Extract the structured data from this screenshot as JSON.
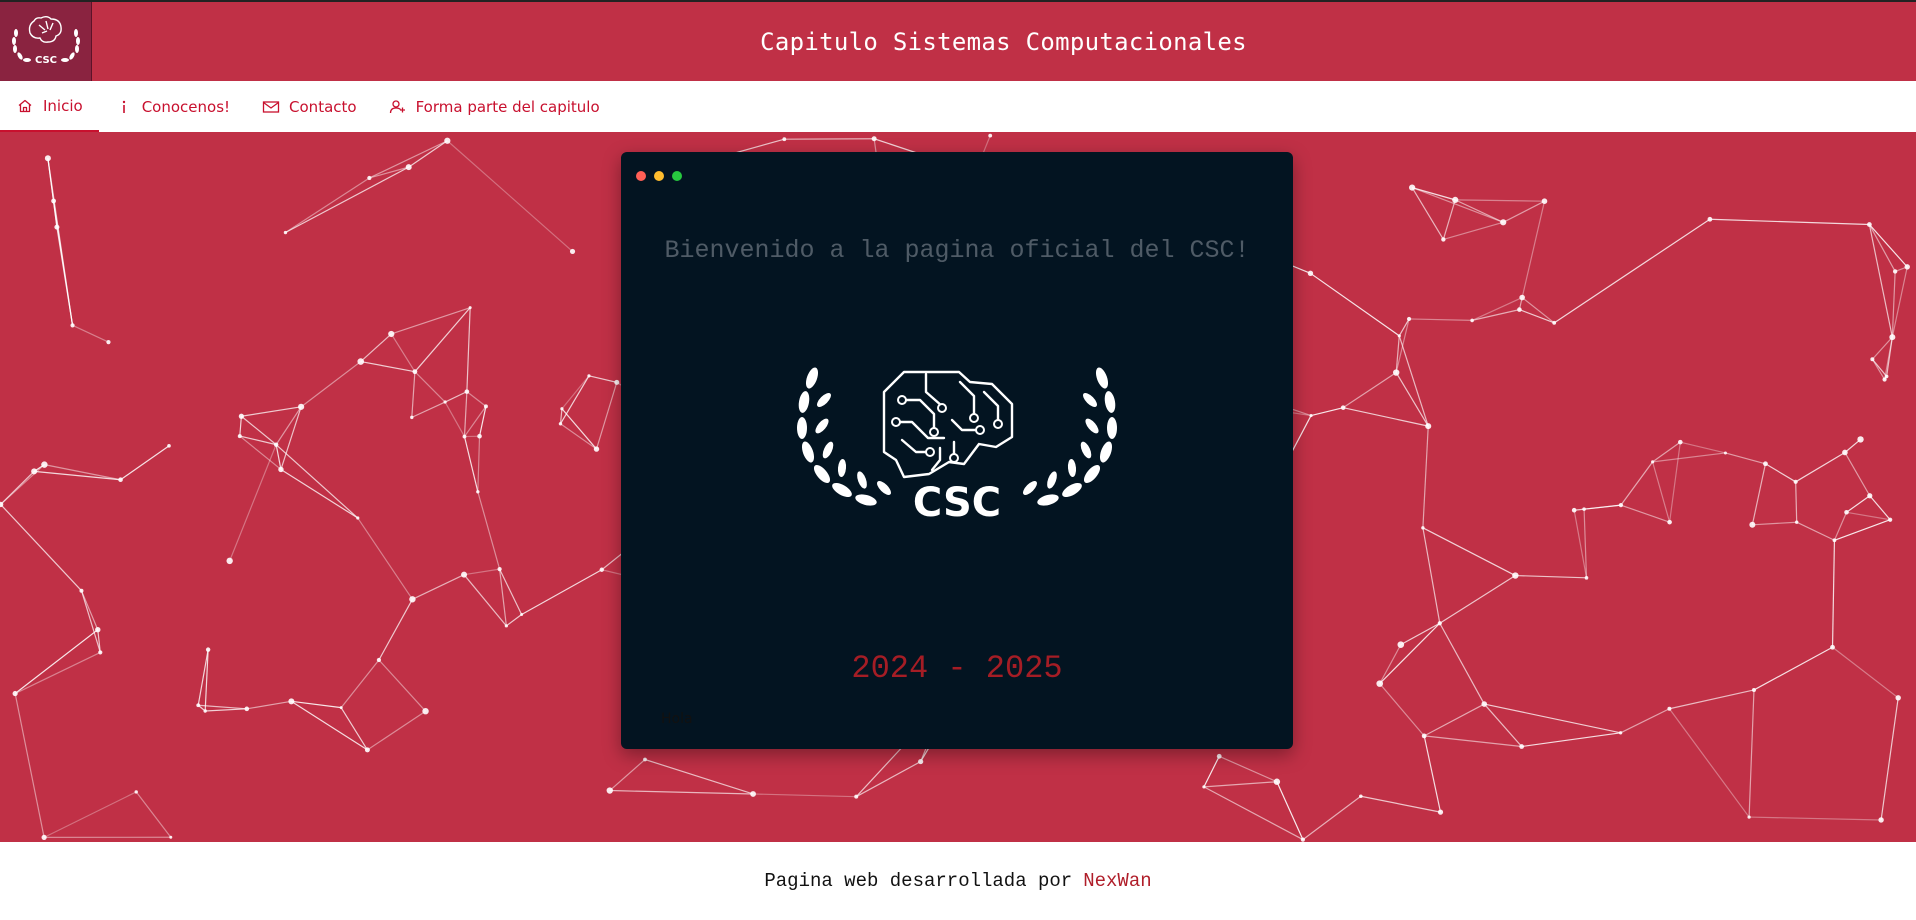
{
  "header": {
    "title": "Capitulo Sistemas Computacionales",
    "logo_text": "CSC"
  },
  "nav": {
    "items": [
      {
        "label": "Inicio",
        "icon": "home-icon",
        "active": true
      },
      {
        "label": "Conocenos!",
        "icon": "info-icon",
        "active": false
      },
      {
        "label": "Contacto",
        "icon": "mail-icon",
        "active": false
      },
      {
        "label": "Forma parte del capitulo",
        "icon": "user-plus-icon",
        "active": false
      }
    ]
  },
  "hero": {
    "welcome": "Bienvenido a la pagina oficial del CSC!",
    "emblem_text": "CSC",
    "years": "2024 - 2025",
    "note": "Hola"
  },
  "footer": {
    "text": "Pagina web desarrollada por",
    "author": "NexWan"
  },
  "colors": {
    "brand_red": "#c03046",
    "logo_bg": "#8a2340",
    "nav_red": "#c8102e",
    "terminal_bg": "#031421",
    "years_red": "#a51d25",
    "author_red": "#b01e2a"
  }
}
